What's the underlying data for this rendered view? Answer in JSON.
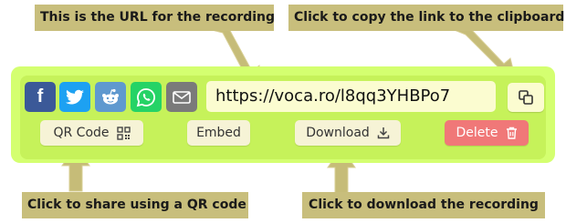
{
  "callouts": {
    "url": "This is the URL for the recording",
    "copy": "Click to copy the link to the clipboard",
    "qr": "Click to share using a QR code",
    "download": "Click to download the recording"
  },
  "share": [
    {
      "name": "facebook",
      "label": "f",
      "color": "#3b5998"
    },
    {
      "name": "twitter",
      "color": "#1da1f2"
    },
    {
      "name": "reddit",
      "color": "#5f99cf"
    },
    {
      "name": "whatsapp",
      "color": "#25d366"
    },
    {
      "name": "email",
      "color": "#7a7a7a"
    }
  ],
  "url": "https://voca.ro/l8qq3YHBPo7",
  "buttons": {
    "qr": "QR Code",
    "embed": "Embed",
    "download": "Download",
    "delete": "Delete"
  },
  "colors": {
    "panel": "#d4ff70",
    "callout": "#c8be7c",
    "arrow": "#c6bc78",
    "delete": "#f07878"
  }
}
